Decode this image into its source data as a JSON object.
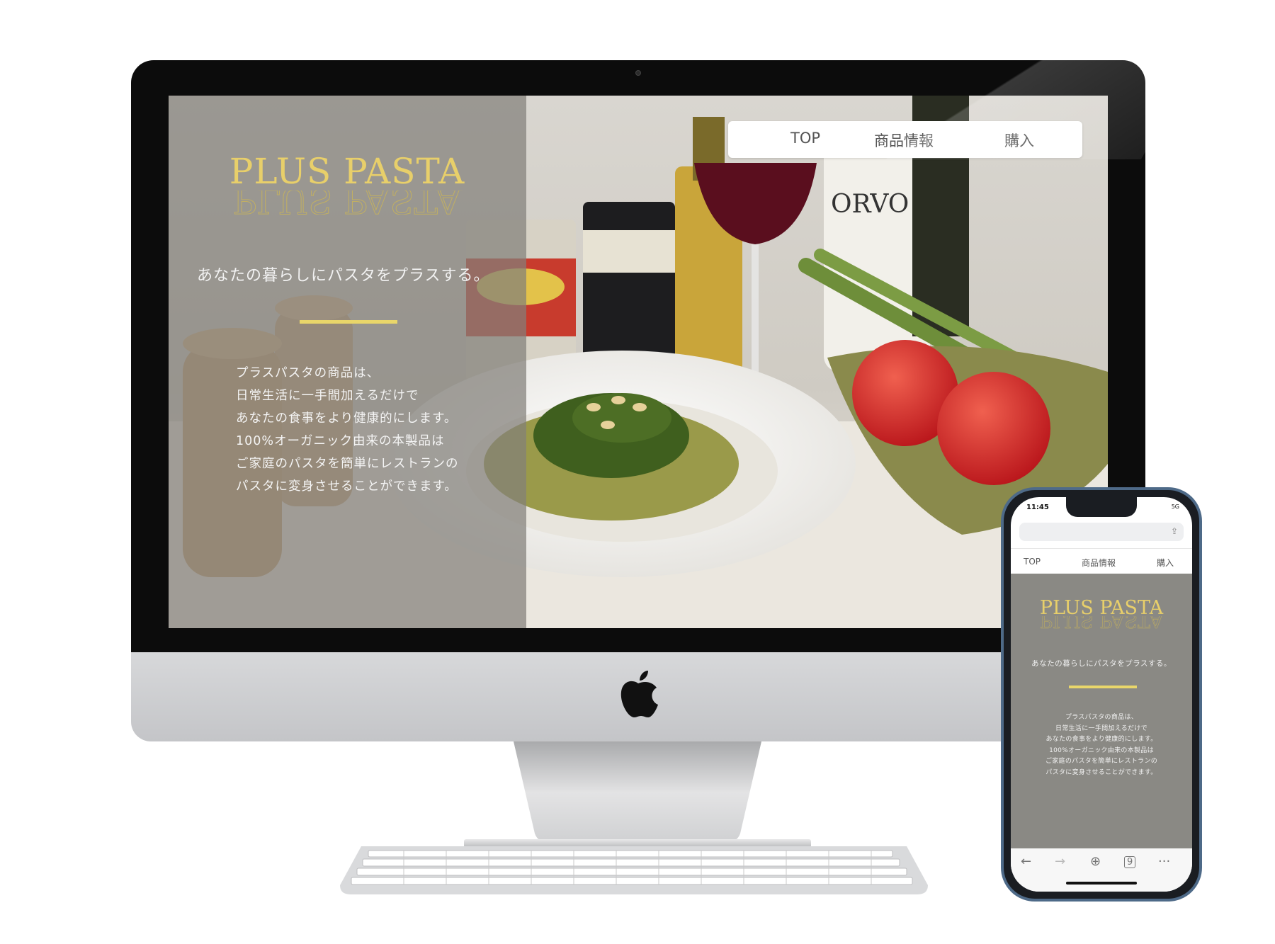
{
  "site": {
    "nav": {
      "top": "TOP",
      "products": "商品情報",
      "purchase": "購入"
    },
    "logo": "PLUS PASTA",
    "tagline": "あなたの暮らしにパスタをプラスする。",
    "description": [
      "プラスパスタの商品は、",
      "日常生活に一手間加えるだけで",
      "あなたの食事をより健康的にします。",
      "100%オーガニック由来の本製品は",
      "ご家庭のパスタを簡単にレストランの",
      "パスタに変身させることができます。"
    ]
  },
  "phone": {
    "time": "11:45",
    "network": "5G",
    "nav": {
      "top": "TOP",
      "products": "商品情報",
      "purchase": "購入"
    },
    "tab_count": "9"
  },
  "colors": {
    "accent_gold": "#e8cf6a",
    "bar_yellow": "#e9d66a",
    "overlay_gray": "#82807a"
  },
  "icons": [
    "apple-logo-icon",
    "share-icon",
    "back-arrow-icon",
    "forward-arrow-icon",
    "new-tab-icon",
    "tabs-icon",
    "more-icon"
  ]
}
